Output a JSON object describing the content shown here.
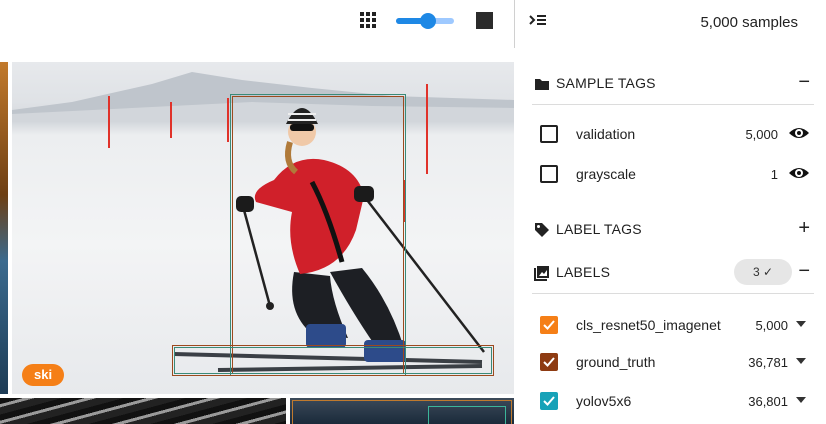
{
  "toolbar": {
    "zoom_level": 0.55
  },
  "grid": {
    "main_tile_tag": "ski"
  },
  "sidebar": {
    "sample_count": "5,000 samples",
    "sample_tags": {
      "title": "SAMPLE TAGS",
      "action": "−",
      "items": [
        {
          "label": "validation",
          "count": "5,000"
        },
        {
          "label": "grayscale",
          "count": "1"
        }
      ]
    },
    "label_tags": {
      "title": "LABEL TAGS",
      "action": "+"
    },
    "labels": {
      "title": "LABELS",
      "filter_count": "3 ✓",
      "action": "−",
      "items": [
        {
          "label": "cls_resnet50_imagenet",
          "count": "5,000",
          "color": "#f57f17"
        },
        {
          "label": "ground_truth",
          "count": "36,781",
          "color": "#8e3b12"
        },
        {
          "label": "yolov5x6",
          "count": "36,801",
          "color": "#17a2b8"
        }
      ]
    }
  },
  "colors": {
    "accent": "#1e88e5",
    "tag_orange": "#f57f17",
    "bbox_green": "#3a8a78",
    "bbox_brown": "#9c4a1e"
  }
}
